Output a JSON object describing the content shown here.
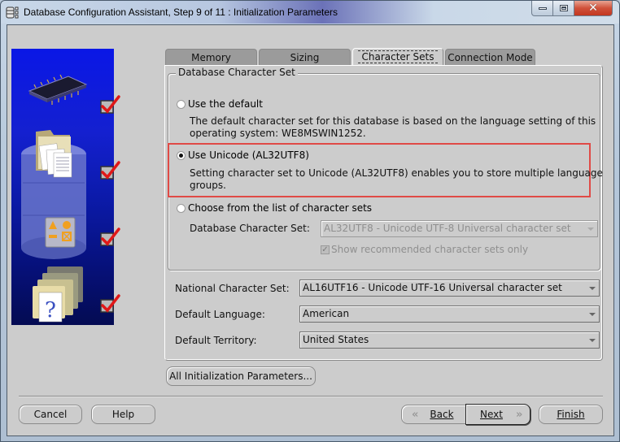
{
  "window": {
    "title": "Database Configuration Assistant, Step 9 of 11 : Initialization Parameters",
    "app_icon": "database-icon",
    "controls": {
      "minimize": "minimize-icon",
      "maximize": "maximize-icon",
      "close": "close-icon"
    }
  },
  "side_panel": {
    "steps": [
      {
        "icon": "memory-chip-icon",
        "checked": true
      },
      {
        "icon": "database-files-icon",
        "checked": true
      },
      {
        "icon": "shapes-icon",
        "checked": true
      },
      {
        "icon": "help-document-icon",
        "checked": true
      }
    ]
  },
  "tabs": [
    {
      "label": "Memory",
      "active": false
    },
    {
      "label": "Sizing",
      "active": false
    },
    {
      "label": "Character Sets",
      "active": true
    },
    {
      "label": "Connection Mode",
      "active": false
    }
  ],
  "db_charset_group": {
    "title": "Database Character Set",
    "options": [
      {
        "label": "Use the default",
        "selected": false,
        "description_lines": [
          "The default character set for this database is based on the language setting of this",
          "operating system: WE8MSWIN1252."
        ]
      },
      {
        "label": "Use Unicode (AL32UTF8)",
        "selected": true,
        "description_lines": [
          "Setting character set to Unicode (AL32UTF8) enables you to store multiple language",
          "groups."
        ]
      },
      {
        "label": "Choose from the list of character sets",
        "selected": false
      }
    ],
    "charset_field": {
      "label": "Database Character Set:",
      "value": "AL32UTF8 - Unicode UTF-8 Universal character set",
      "enabled": false
    },
    "show_recommended": {
      "label": "Show recommended character sets only",
      "checked": true,
      "enabled": false
    }
  },
  "fields": [
    {
      "label": "National Character Set:",
      "value": "AL16UTF16 - Unicode UTF-16 Universal character set"
    },
    {
      "label": "Default Language:",
      "value": "American"
    },
    {
      "label": "Default Territory:",
      "value": "United States"
    }
  ],
  "all_params_button": "All Initialization Parameters...",
  "footer": {
    "cancel": "Cancel",
    "help": "Help",
    "back": "Back",
    "next": "Next",
    "finish": "Finish"
  },
  "colors": {
    "highlight_border": "#e04a46",
    "dialog_bg": "#cccccc",
    "side_panel_blue": "#0a17e6"
  }
}
